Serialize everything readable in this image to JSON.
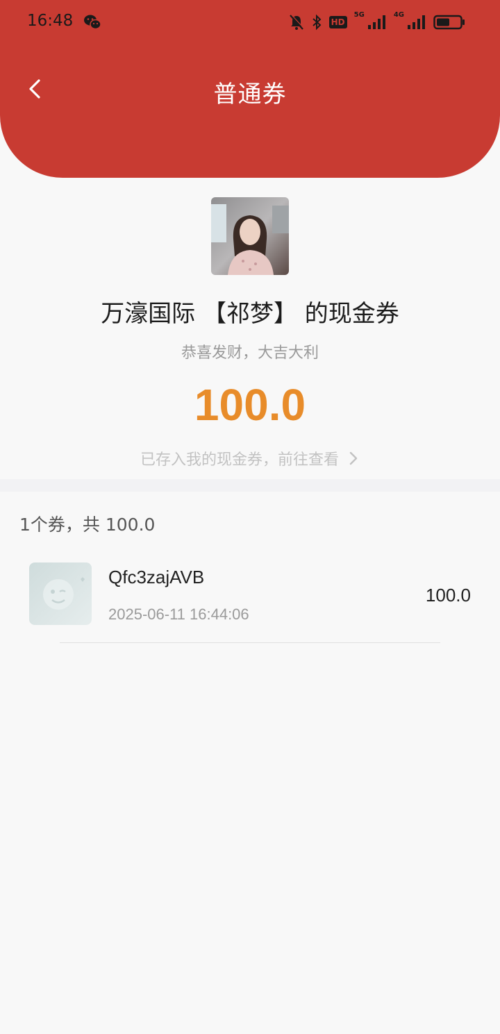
{
  "status_bar": {
    "time": "16:48",
    "icons": [
      "wechat-icon",
      "mute-bell-icon",
      "bluetooth-icon",
      "hd-badge",
      "signal-5g-icon",
      "signal-4g-icon",
      "battery-icon"
    ],
    "hd_label": "HD",
    "net1": "5G",
    "net2": "4G"
  },
  "header": {
    "title": "普通券",
    "back_icon": "chevron-left-icon",
    "color": "#c83b32"
  },
  "coupon": {
    "sender_title": "万濠国际 【祁梦】 的现金券",
    "greeting": "恭喜发财，大吉大利",
    "amount": "100.0",
    "amount_color": "#e88c2a",
    "stored_text": "已存入我的现金券，前往查看"
  },
  "summary": "1个券，共 100.0",
  "items": [
    {
      "name": "Qfc3zajAVB",
      "time": "2025-06-11 16:44:06",
      "amount": "100.0"
    }
  ]
}
